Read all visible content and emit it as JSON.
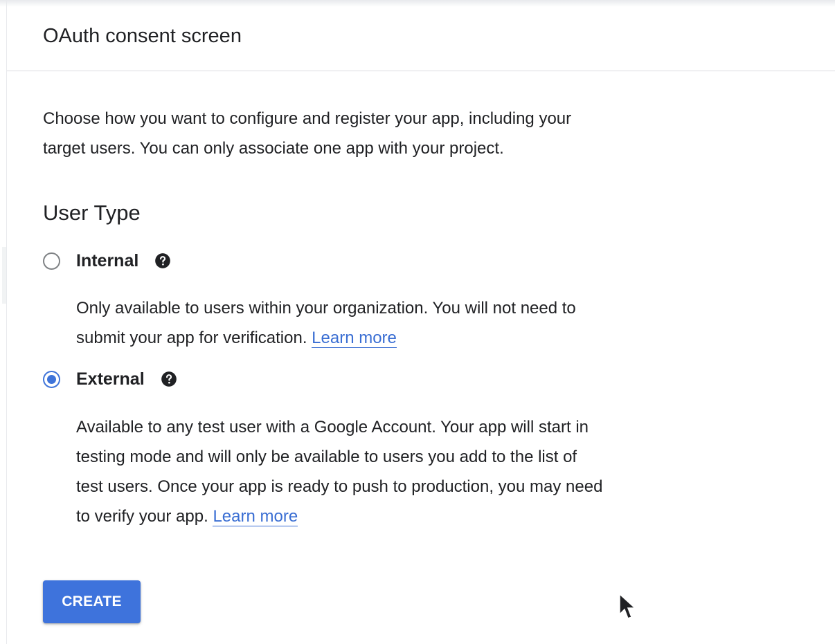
{
  "header": {
    "title": "OAuth consent screen"
  },
  "intro": {
    "text_line1": "Choose how you want to configure and register your app, including your",
    "text_line2": "target users. You can only associate one app with your project."
  },
  "user_type": {
    "title": "User Type",
    "selected": "External",
    "options": [
      {
        "label": "Internal",
        "checked": false,
        "icon": "help-icon",
        "description_line1": "Only available to users within your organization. You will not need to",
        "description_line2": "submit your app for verification.",
        "link": "Learn more"
      },
      {
        "label": "External",
        "checked": true,
        "icon": "help-icon",
        "description_line1": "Available to any test user with a Google Account. Your app will start in",
        "description_line2": "testing mode and will only be available to users you add to the list of",
        "description_line3": "test users. Once your app is ready to push to production, you may need",
        "description_line4": "to verify your app.",
        "link": "Learn more"
      }
    ]
  },
  "actions": {
    "create_label": "CREATE"
  },
  "colors": {
    "accent": "#3e73dc",
    "link": "#3a6ed3",
    "text": "#202124",
    "divider": "#dadce0"
  }
}
